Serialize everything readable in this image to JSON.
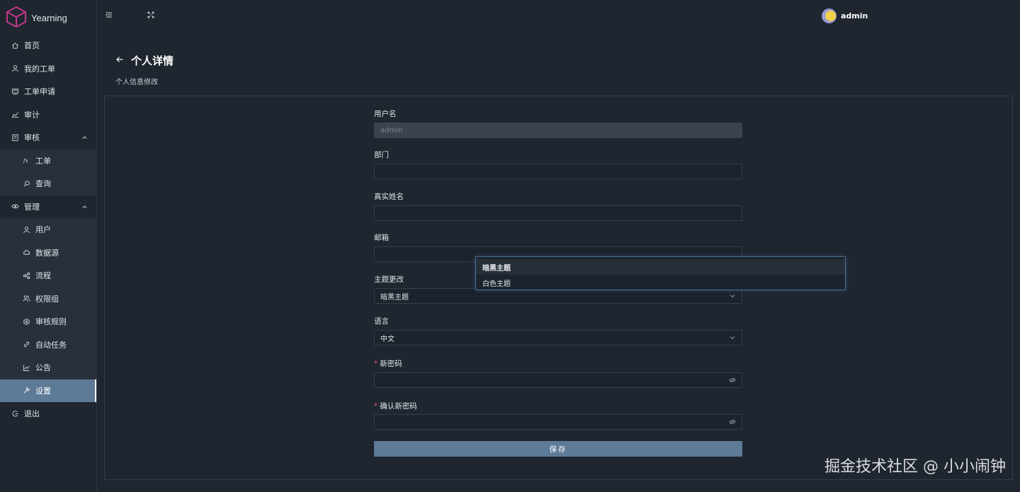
{
  "app": {
    "name": "Yearning"
  },
  "header": {
    "user_name": "admin"
  },
  "sidebar": {
    "items": [
      {
        "label": "首页",
        "icon": "home-icon"
      },
      {
        "label": "我的工单",
        "icon": "user-icon"
      },
      {
        "label": "工单申请",
        "icon": "form-icon"
      },
      {
        "label": "审计",
        "icon": "chart-icon"
      },
      {
        "label": "审核",
        "icon": "audit-icon"
      },
      {
        "label": "工单",
        "icon": "fx-icon"
      },
      {
        "label": "查询",
        "icon": "search-icon"
      },
      {
        "label": "管理",
        "icon": "eye-icon"
      },
      {
        "label": "用户",
        "icon": "user-icon"
      },
      {
        "label": "数据源",
        "icon": "cloud-icon"
      },
      {
        "label": "流程",
        "icon": "flow-icon"
      },
      {
        "label": "权限组",
        "icon": "group-icon"
      },
      {
        "label": "审核规则",
        "icon": "rule-icon"
      },
      {
        "label": "自动任务",
        "icon": "link-icon"
      },
      {
        "label": "公告",
        "icon": "stock-icon"
      },
      {
        "label": "设置",
        "icon": "tool-icon"
      },
      {
        "label": "退出",
        "icon": "logout-icon"
      }
    ]
  },
  "page": {
    "title": "个人详情",
    "subtitle": "个人信息修改"
  },
  "form": {
    "username_label": "用户名",
    "username_value": "admin",
    "department_label": "部门",
    "department_value": "",
    "realname_label": "真实姓名",
    "realname_value": "",
    "email_label": "邮箱",
    "email_value": "",
    "theme_label": "主题更改",
    "theme_value": "暗黑主题",
    "language_label": "语言",
    "language_value": "中文",
    "new_password_label": "新密码",
    "confirm_password_label": "确认新密码",
    "required_mark": "*",
    "save_label": "保存"
  },
  "dropdown": {
    "options": [
      "暗黑主题",
      "白色主题"
    ],
    "selected": "暗黑主题"
  },
  "watermark": "掘金技术社区 @ 小小闹钟",
  "colors": {
    "background": "#1f2630",
    "accent": "#5d7a97",
    "required": "#e0545c",
    "dropdown_border": "#4e6e96"
  }
}
